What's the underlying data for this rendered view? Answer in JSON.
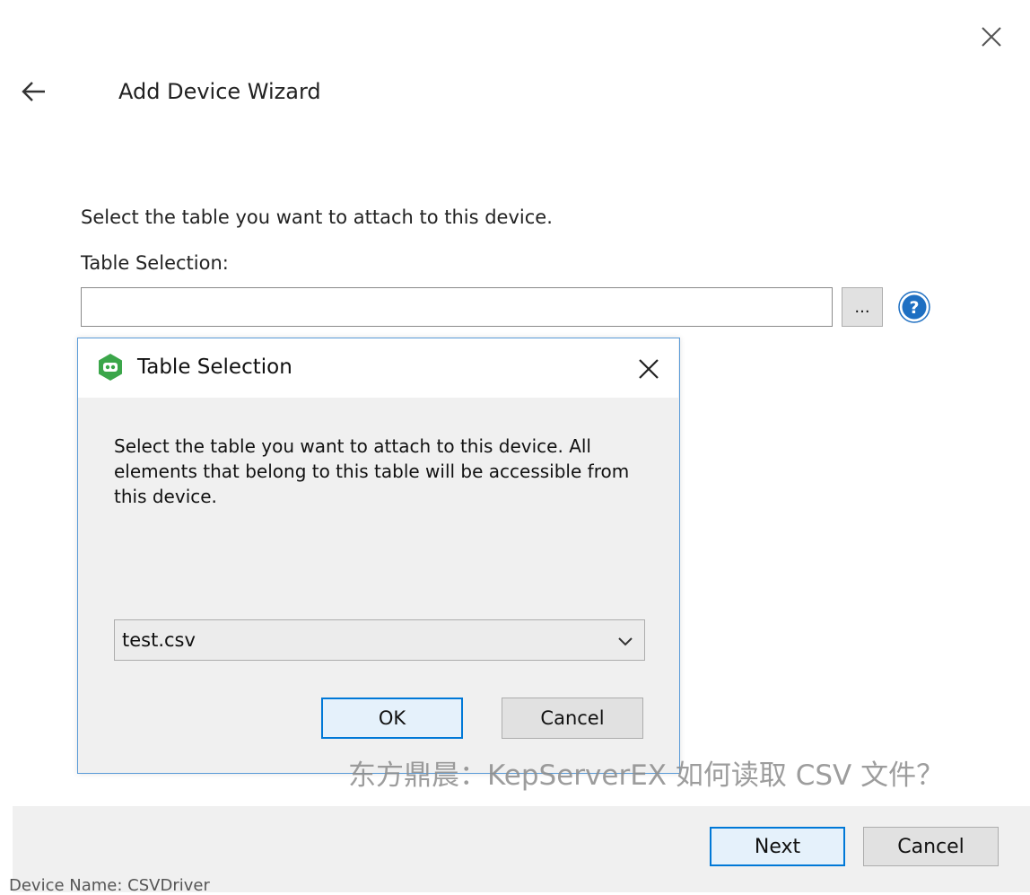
{
  "wizard": {
    "title": "Add Device Wizard",
    "instruction": "Select the table you want to attach to this device.",
    "field_label": "Table Selection:",
    "field_value": "",
    "browse_label": "...",
    "next_label": "Next",
    "cancel_label": "Cancel",
    "cut_off_text": "Device Name: CSVDriver"
  },
  "dialog": {
    "title": "Table Selection",
    "description": "Select the table you want to attach to this device. All elements that belong to this table will be accessible from this device.",
    "selected_table": "test.csv",
    "ok_label": "OK",
    "cancel_label": "Cancel"
  },
  "watermark": "东方鼎晨：KepServerEX 如何读取 CSV 文件？",
  "colors": {
    "accent_border": "#0078d7",
    "default_button_bg": "#e5f1fb",
    "help_icon": "#1e6fc2",
    "app_icon": "#3ba64a"
  },
  "icons": [
    "close-icon",
    "back-arrow-icon",
    "help-icon",
    "app-icon",
    "chevron-down-icon"
  ]
}
